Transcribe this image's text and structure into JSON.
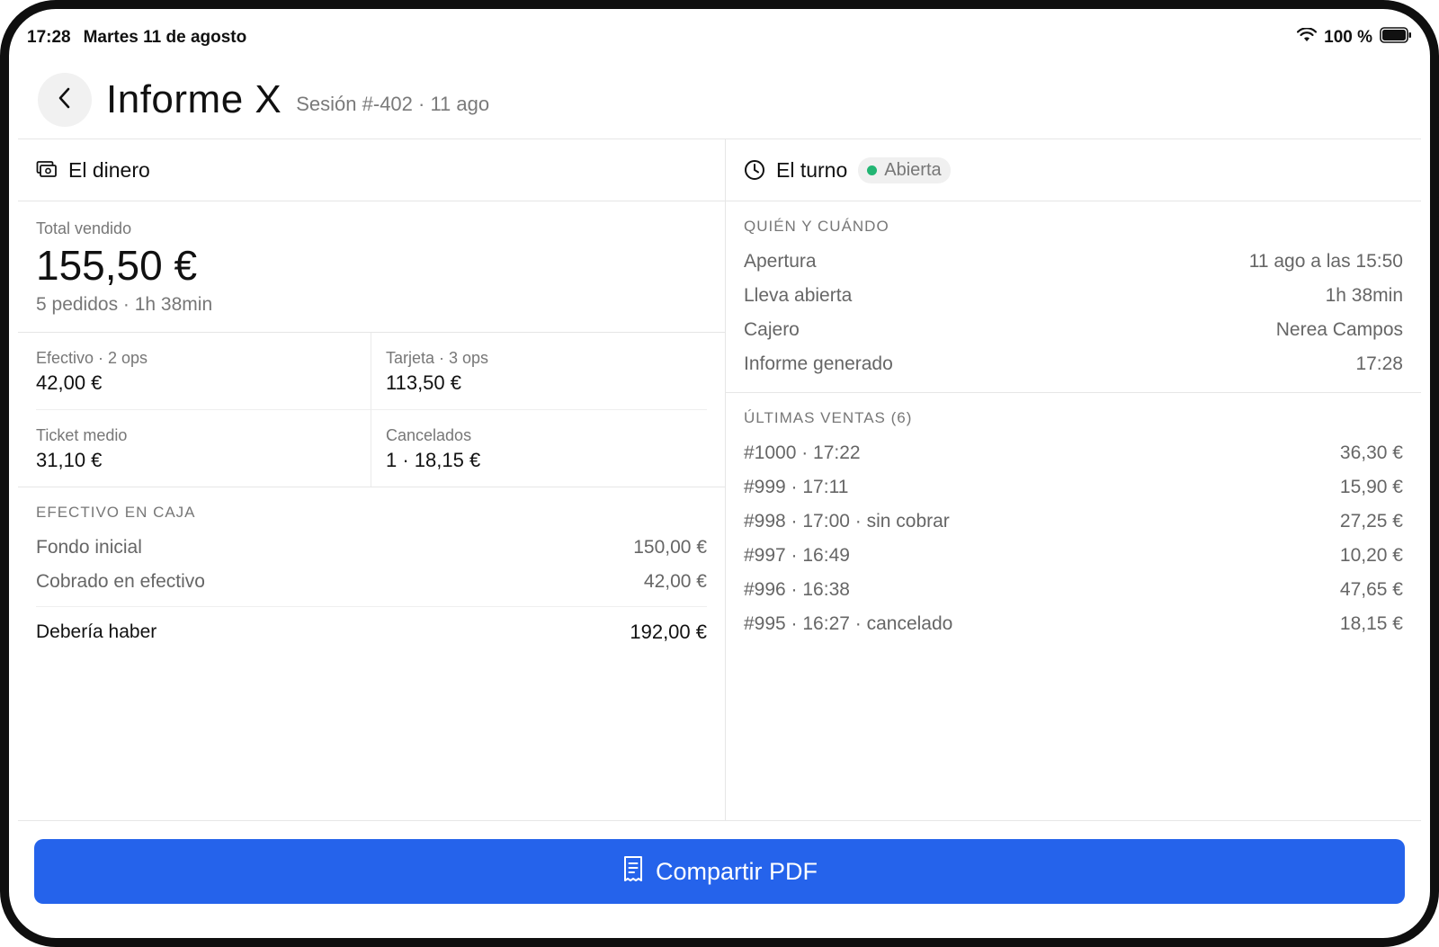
{
  "status": {
    "time": "17:28",
    "date": "Martes 11 de agosto",
    "battery": "100 %"
  },
  "header": {
    "title": "Informe X",
    "subtitle": "Sesión #-402 · 11 ago"
  },
  "money": {
    "heading": "El dinero",
    "total_label": "Total vendido",
    "total_value": "155,50 €",
    "total_meta": "5 pedidos · 1h 38min",
    "stats": [
      {
        "label": "Efectivo · 2 ops",
        "value": "42,00 €"
      },
      {
        "label": "Tarjeta · 3 ops",
        "value": "113,50 €"
      },
      {
        "label": "Ticket medio",
        "value": "31,10 €"
      },
      {
        "label": "Cancelados",
        "value": "1 · 18,15 €"
      }
    ],
    "cash_caption": "EFECTIVO EN CAJA",
    "cash_rows": [
      {
        "label": "Fondo inicial",
        "value": "150,00 €"
      },
      {
        "label": "Cobrado en efectivo",
        "value": "42,00 €"
      }
    ],
    "cash_total": {
      "label": "Debería haber",
      "value": "192,00 €"
    }
  },
  "shift": {
    "heading": "El turno",
    "badge": "Abierta",
    "who_caption": "QUIÉN Y CUÁNDO",
    "who_rows": [
      {
        "label": "Apertura",
        "value": "11 ago a las 15:50"
      },
      {
        "label": "Lleva abierta",
        "value": "1h 38min"
      },
      {
        "label": "Cajero",
        "value": "Nerea Campos"
      },
      {
        "label": "Informe generado",
        "value": "17:28"
      }
    ],
    "sales_caption": "ÚLTIMAS VENTAS (6)",
    "sales": [
      {
        "label": "#1000 · 17:22",
        "value": "36,30 €"
      },
      {
        "label": "#999 · 17:11",
        "value": "15,90 €"
      },
      {
        "label": "#998 · 17:00 · sin cobrar",
        "value": "27,25 €"
      },
      {
        "label": "#997 · 16:49",
        "value": "10,20 €"
      },
      {
        "label": "#996 · 16:38",
        "value": "47,65 €"
      },
      {
        "label": "#995 · 16:27 · cancelado",
        "value": "18,15 €"
      }
    ]
  },
  "footer": {
    "share_label": "Compartir PDF"
  },
  "colors": {
    "accent": "#2563eb",
    "status_open": "#22b573"
  },
  "icons": {
    "back": "chevron-left-icon",
    "money": "cash-icon",
    "shift": "clock-icon",
    "share": "receipt-icon"
  }
}
